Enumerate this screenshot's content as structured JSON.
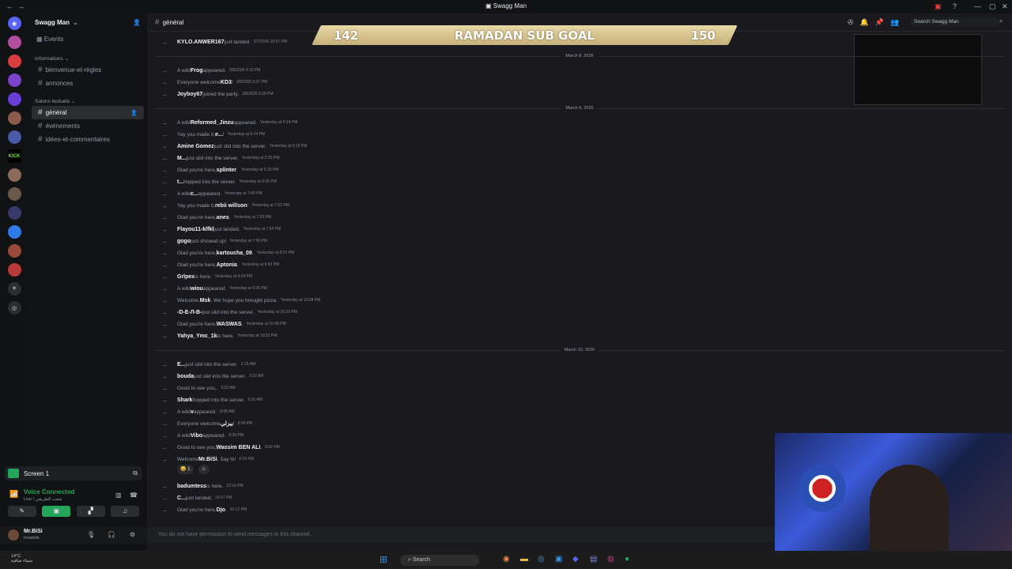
{
  "window": {
    "title": "Swagg Man",
    "controls": [
      "—",
      "▢",
      "✕"
    ]
  },
  "server": {
    "name": "Swagg Man",
    "events_label": "Events",
    "categories": [
      {
        "label": "Informations",
        "channels": [
          "bienvenue-et-règles",
          "annonces"
        ]
      },
      {
        "label": "Salons textuels",
        "channels": [
          "général",
          "événements",
          "idées-et-commentaires"
        ]
      }
    ]
  },
  "guild_icons": [
    "discord-home",
    "server-1",
    "server-2",
    "server-3",
    "server-4",
    "server-5",
    "server-6",
    "kick",
    "server-8",
    "server-9",
    "server-10",
    "server-11",
    "server-12",
    "server-13",
    "add-server",
    "discover"
  ],
  "guild_kick_label": "KICK",
  "screen_share": {
    "label": "Screen 1"
  },
  "voice": {
    "status": "Voice Connected",
    "subtitle": "Live / شعب الطريقي"
  },
  "user": {
    "name": "Mr.BiSi",
    "status": "Invisible"
  },
  "channel": {
    "name": "général"
  },
  "header_search_placeholder": "Search Swagg Man",
  "sub_goal": {
    "start": "142",
    "title": "RAMADAN SUB GOAL",
    "end": "150"
  },
  "dates": [
    "March 8, 2026",
    "March 9, 2026",
    "March 10, 2026"
  ],
  "messages": [
    {
      "pre": "",
      "user": "KYLO.ANWER167",
      "post": " just landed.",
      "time": "3/7/2026 10:57 PM"
    },
    {
      "pre": "A wild ",
      "user": "Frog",
      "post": " appeared.",
      "time": "3/8/2026 4:10 PM"
    },
    {
      "pre": "Everyone welcome ",
      "user": "KD3",
      "post": "!",
      "time": "3/8/2026 5:27 PM"
    },
    {
      "pre": "",
      "user": "Joyboy67",
      "post": " joined the party.",
      "time": "3/8/2026 5:28 PM"
    },
    {
      "pre": "A wild ",
      "user": "Reformed_Jinzu",
      "post": " appeared.",
      "time": "Yesterday at 5:14 PM"
    },
    {
      "pre": "Yay you made it, ",
      "user": "e...",
      "post": "!",
      "time": "Yesterday at 5:14 PM"
    },
    {
      "pre": "",
      "user": "Amine Gomez",
      "post": " just slid into the server.",
      "time": "Yesterday at 5:15 PM"
    },
    {
      "pre": "",
      "user": "M...",
      "post": " just slid into the server.",
      "time": "Yesterday at 5:15 PM"
    },
    {
      "pre": "Glad you're here, ",
      "user": "splinter",
      "post": ".",
      "time": "Yesterday at 5:15 PM"
    },
    {
      "pre": "",
      "user": "t...",
      "post": " hopped into the server.",
      "time": "Yesterday at 6:06 PM"
    },
    {
      "pre": "A wild ",
      "user": "c...",
      "post": " appeared.",
      "time": "Yesterday at 7:40 PM"
    },
    {
      "pre": "Yay you made it, ",
      "user": "rebii willson",
      "post": "!",
      "time": "Yesterday at 7:52 PM"
    },
    {
      "pre": "Glad you're here, ",
      "user": "anes",
      "post": ".",
      "time": "Yesterday at 7:53 PM"
    },
    {
      "pre": "",
      "user": "Flayou11-klfkl",
      "post": " just landed.",
      "time": "Yesterday at 7:54 PM"
    },
    {
      "pre": "",
      "user": "gogo",
      "post": " just showed up!",
      "time": "Yesterday at 7:56 PM"
    },
    {
      "pre": "Glad you're here, ",
      "user": "kartoucha_09",
      "post": ".",
      "time": "Yesterday at 8:31 PM"
    },
    {
      "pre": "Glad you're here, ",
      "user": "Aptonia",
      "post": ".",
      "time": "Yesterday at 8:43 PM"
    },
    {
      "pre": "",
      "user": "Grlpex",
      "post": " is here.",
      "time": "Yesterday at 9:24 PM"
    },
    {
      "pre": "A wild ",
      "user": "wiou",
      "post": " appeared.",
      "time": "Yesterday at 9:26 PM"
    },
    {
      "pre": "Welcome, ",
      "user": "Msk",
      "post": ". We hope you brought pizza.",
      "time": "Yesterday at 10:28 PM"
    },
    {
      "pre": "",
      "user": "-D-E-Л-B-",
      "post": " just slid into the server.",
      "time": "Yesterday at 10:29 PM"
    },
    {
      "pre": "Glad you're here, ",
      "user": "WASWAS",
      "post": ".",
      "time": "Yesterday at 10:46 PM"
    },
    {
      "pre": "",
      "user": "Yahya_Ymc_1k",
      "post": " is here.",
      "time": "Yesterday at 10:52 PM"
    },
    {
      "pre": "",
      "user": "E...",
      "post": " just slid into the server.",
      "time": "2:15 AM"
    },
    {
      "pre": "",
      "user": "bouda",
      "post": " just slid into the server.",
      "time": "3:22 AM"
    },
    {
      "pre": "Good to see you, ",
      "user": "",
      "post": ".",
      "time": "3:22 AM"
    },
    {
      "pre": "",
      "user": "Shark",
      "post": " hopped into the server.",
      "time": "6:31 AM"
    },
    {
      "pre": "A wild ",
      "user": "v",
      "post": " appeared.",
      "time": "8:08 AM"
    },
    {
      "pre": "Everyone welcome ",
      "user": "بيزلي",
      "post": "!",
      "time": "8:06 PM"
    },
    {
      "pre": "A wild ",
      "user": "Vibo",
      "post": " appeared.",
      "time": "8:30 PM"
    },
    {
      "pre": "Good to see you, ",
      "user": "Wassim BEN ALI",
      "post": ".",
      "time": "8:52 PM"
    },
    {
      "pre": "Welcome ",
      "user": "Mr.BiSi",
      "post": ". Say hi!",
      "time": "9:10 PM"
    },
    {
      "pre": "",
      "user": "badumtess",
      "post": " is here.",
      "time": "10:16 PM"
    },
    {
      "pre": "",
      "user": "C...",
      "post": " just landed.",
      "time": "10:17 PM"
    },
    {
      "pre": "Glad you're here, ",
      "user": "Djo",
      "post": ".",
      "time": "10:17 PM"
    }
  ],
  "reactions": [
    {
      "emoji": "😄",
      "count": "1"
    },
    {
      "emoji": "☺",
      "count": ""
    }
  ],
  "no_permission": "You do not have permission to send messages in this channel.",
  "taskbar": {
    "search_label": "Search",
    "weather_temp": "14°C",
    "weather_desc": "سماء صافية"
  }
}
